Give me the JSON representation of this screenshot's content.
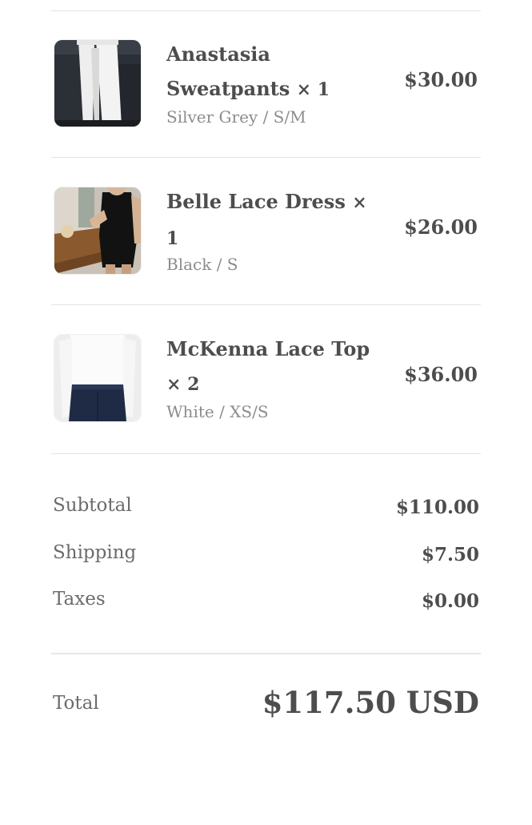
{
  "items": [
    {
      "name": "Anastasia Sweatpants",
      "quantity": "× 1",
      "variant": "Silver Grey / S/M",
      "price": "$30.00",
      "thumbnail": "white-sweatpants-photo"
    },
    {
      "name": "Belle Lace Dress",
      "quantity": "× 1",
      "variant": "Black / S",
      "price": "$26.00",
      "thumbnail": "black-dress-photo"
    },
    {
      "name": "McKenna Lace Top",
      "quantity": "× 2",
      "variant": "White / XS/S",
      "price": "$36.00",
      "thumbnail": "white-top-photo"
    }
  ],
  "summary": {
    "subtotal_label": "Subtotal",
    "subtotal_value": "$110.00",
    "shipping_label": "Shipping",
    "shipping_value": "$7.50",
    "taxes_label": "Taxes",
    "taxes_value": "$0.00"
  },
  "total": {
    "label": "Total",
    "value": "$117.50 USD"
  },
  "colors": {
    "text_dark": "#4d4d4d",
    "text_muted": "#8c8c8c",
    "divider": "#e3e3e3"
  }
}
